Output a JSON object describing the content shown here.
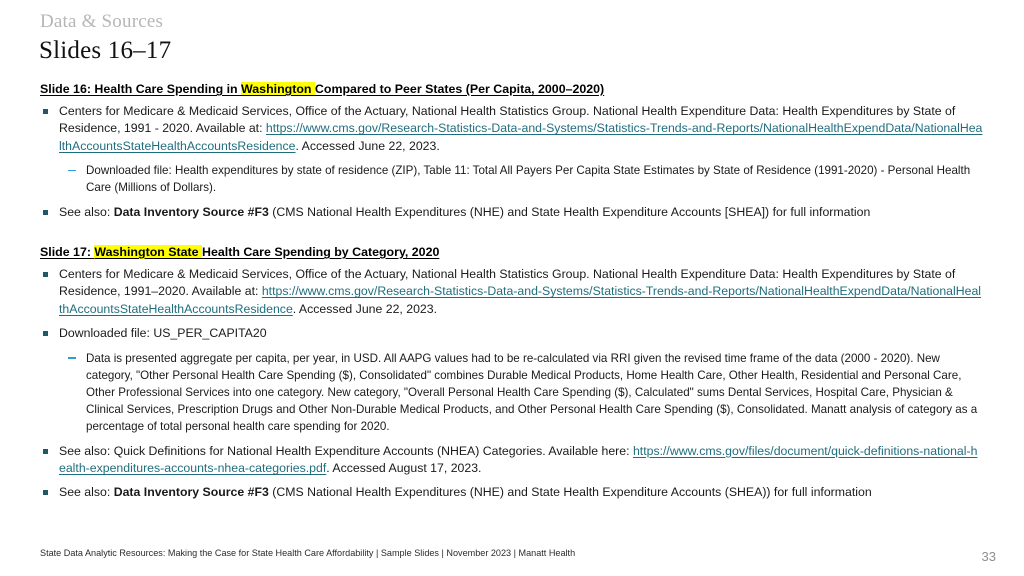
{
  "header": {
    "eyebrow": "Data & Sources",
    "title": "Slides 16–17"
  },
  "colors": {
    "bullet_square": "#1f5866",
    "bullet_dash": "#2e9fd4",
    "link": "#1f6e7e",
    "highlight": "#ffff00",
    "eyebrow": "#b6b6b6",
    "page_number": "#8f8f8f"
  },
  "sections": [
    {
      "heading_prefix": "Slide 16: Health Care Spending in ",
      "heading_highlight": "Washington ",
      "heading_suffix": "Compared to Peer States (Per Capita, 2000–2020)",
      "bullet1_text_a": "Centers for Medicare & Medicaid Services, Office of the Actuary, National Health Statistics Group. National Health Expenditure Data: Health Expenditures by State of Residence, 1991 - 2020. Available at: ",
      "bullet1_url": "https://www.cms.gov/Research-Statistics-Data-and-Systems/Statistics-Trends-and-Reports/NationalHealthExpendData/NationalHealthAccountsStateHealthAccountsResidence",
      "bullet1_text_b": ". Accessed June 22, 2023.",
      "sub1_text": "Downloaded file: Health expenditures by state of residence (ZIP), Table 11: Total All Payers Per Capita State Estimates by State of Residence (1991-2020) - Personal Health Care (Millions of Dollars).",
      "bullet2_text_a": "See also: ",
      "bullet2_bold": "Data Inventory Source #F3",
      "bullet2_text_b": " (CMS National Health Expenditures (NHE)  and State Health Expenditure Accounts [SHEA]) for full information"
    },
    {
      "heading_prefix": "Slide 17: ",
      "heading_highlight": "Washington State ",
      "heading_suffix": "Health Care Spending by Category, 2020",
      "bullet1_text_a": "Centers for Medicare & Medicaid Services, Office of the Actuary, National Health Statistics Group. National Health Expenditure Data: Health Expenditures by State of Residence, 1991–2020. Available at: ",
      "bullet1_url": "https://www.cms.gov/Research-Statistics-Data-and-Systems/Statistics-Trends-and-Reports/NationalHealthExpendData/NationalHealthAccountsStateHealthAccountsResidence",
      "bullet1_text_b": ". Accessed June 22, 2023.",
      "bullet2_text": "Downloaded file: US_PER_CAPITA20",
      "sub1_text": "Data is presented aggregate per capita, per year, in USD. All AAPG values had to be re-calculated via RRI given the revised time frame of the data (2000 - 2020). New category, \"Other Personal Health Care Spending ($), Consolidated\" combines Durable Medical Products, Home Health Care, Other Health, Residential and Personal Care, Other Professional Services into one category. New category, \"Overall Personal Health Care Spending ($), Calculated\" sums Dental Services, Hospital Care, Physician & Clinical Services, Prescription Drugs and Other Non-Durable Medical Products, and Other Personal Health Care Spending ($), Consolidated. Manatt analysis of category as a percentage of total personal health care spending for 2020.",
      "bullet3_text_a": "See also: Quick Definitions for National Health Expenditure Accounts (NHEA) Categories. Available here: ",
      "bullet3_url": "https://www.cms.gov/files/document/quick-definitions-national-health-expenditures-accounts-nhea-categories.pdf",
      "bullet3_text_b": ".  Accessed August 17, 2023.",
      "bullet4_text_a": "See also: ",
      "bullet4_bold": "Data Inventory Source #F3",
      "bullet4_text_b": " (CMS National Health Expenditures (NHE)  and State Health Expenditure Accounts (SHEA)) for full information"
    }
  ],
  "footer": {
    "text": "State Data Analytic Resources: Making the Case for State Health Care Affordability | Sample Slides | November 2023 | Manatt Health",
    "page_number": "33"
  }
}
